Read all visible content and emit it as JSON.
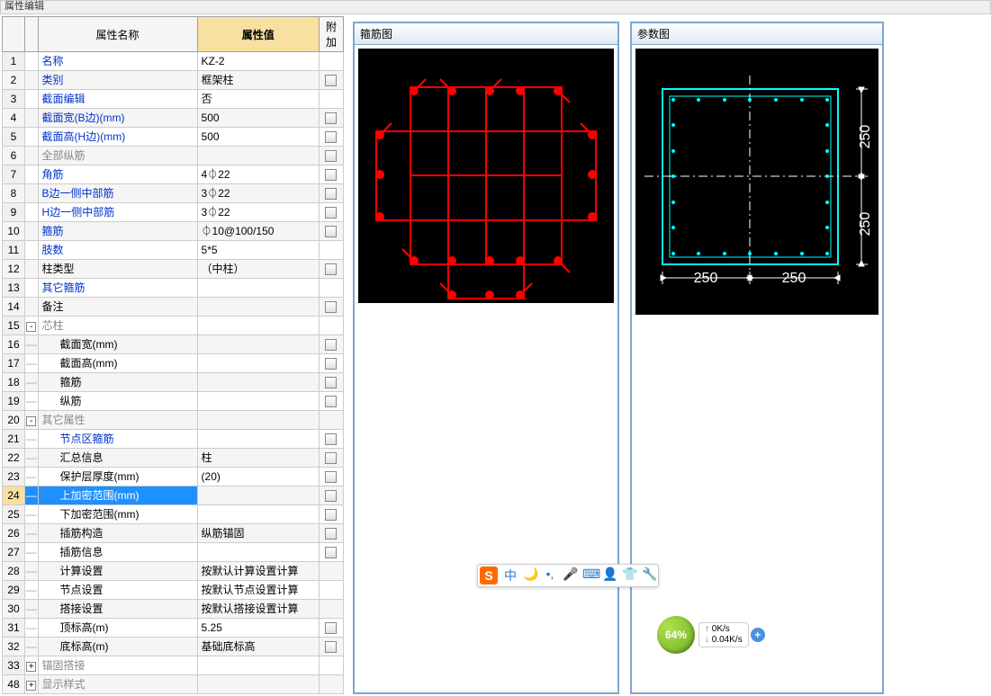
{
  "window_title": "属性编辑",
  "table": {
    "headers": {
      "name": "属性名称",
      "value": "属性值",
      "extra": "附加"
    },
    "rows": [
      {
        "n": "1",
        "name": "名称",
        "value": "KZ-2",
        "blue": true,
        "check": false
      },
      {
        "n": "2",
        "name": "类别",
        "value": "框架柱",
        "blue": true,
        "check": true
      },
      {
        "n": "3",
        "name": "截面编辑",
        "value": "否",
        "blue": true,
        "check": false
      },
      {
        "n": "4",
        "name": "截面宽(B边)(mm)",
        "value": "500",
        "blue": true,
        "check": true
      },
      {
        "n": "5",
        "name": "截面高(H边)(mm)",
        "value": "500",
        "blue": true,
        "check": true
      },
      {
        "n": "6",
        "name": "全部纵筋",
        "value": "",
        "gray": true,
        "check": true
      },
      {
        "n": "7",
        "name": "角筋",
        "value": "4⏀22",
        "blue": true,
        "check": true
      },
      {
        "n": "8",
        "name": "B边一侧中部筋",
        "value": "3⏀22",
        "blue": true,
        "check": true
      },
      {
        "n": "9",
        "name": "H边一侧中部筋",
        "value": "3⏀22",
        "blue": true,
        "check": true
      },
      {
        "n": "10",
        "name": "箍筋",
        "value": "⏀10@100/150",
        "blue": true,
        "check": true
      },
      {
        "n": "11",
        "name": "肢数",
        "value": "5*5",
        "blue": true,
        "check": false
      },
      {
        "n": "12",
        "name": "柱类型",
        "value": "（中柱）",
        "blue": false,
        "check": true
      },
      {
        "n": "13",
        "name": "其它箍筋",
        "value": "",
        "blue": true,
        "check": false
      },
      {
        "n": "14",
        "name": "备注",
        "value": "",
        "blue": false,
        "check": true
      },
      {
        "n": "15",
        "name": "芯柱",
        "value": "",
        "gray": true,
        "expand": "-"
      },
      {
        "n": "16",
        "name": "截面宽(mm)",
        "value": "",
        "blue": false,
        "indent": true,
        "check": true
      },
      {
        "n": "17",
        "name": "截面高(mm)",
        "value": "",
        "blue": false,
        "indent": true,
        "check": true
      },
      {
        "n": "18",
        "name": "箍筋",
        "value": "",
        "blue": false,
        "indent": true,
        "check": true
      },
      {
        "n": "19",
        "name": "纵筋",
        "value": "",
        "blue": false,
        "indent": true,
        "check": true
      },
      {
        "n": "20",
        "name": "其它属性",
        "value": "",
        "gray": true,
        "expand": "-"
      },
      {
        "n": "21",
        "name": "节点区箍筋",
        "value": "",
        "blue": true,
        "indent": true,
        "check": true
      },
      {
        "n": "22",
        "name": "汇总信息",
        "value": "柱",
        "blue": false,
        "indent": true,
        "check": true
      },
      {
        "n": "23",
        "name": "保护层厚度(mm)",
        "value": "(20)",
        "blue": false,
        "indent": true,
        "check": true
      },
      {
        "n": "24",
        "name": "上加密范围(mm)",
        "value": "",
        "blue": false,
        "indent": true,
        "check": true,
        "selected": true
      },
      {
        "n": "25",
        "name": "下加密范围(mm)",
        "value": "",
        "blue": false,
        "indent": true,
        "check": true
      },
      {
        "n": "26",
        "name": "插筋构造",
        "value": "纵筋锚固",
        "blue": false,
        "indent": true,
        "check": true
      },
      {
        "n": "27",
        "name": "插筋信息",
        "value": "",
        "blue": false,
        "indent": true,
        "check": true
      },
      {
        "n": "28",
        "name": "计算设置",
        "value": "按默认计算设置计算",
        "blue": false,
        "indent": true,
        "check": false
      },
      {
        "n": "29",
        "name": "节点设置",
        "value": "按默认节点设置计算",
        "blue": false,
        "indent": true,
        "check": false
      },
      {
        "n": "30",
        "name": "搭接设置",
        "value": "按默认搭接设置计算",
        "blue": false,
        "indent": true,
        "check": false
      },
      {
        "n": "31",
        "name": "顶标高(m)",
        "value": "5.25",
        "blue": false,
        "indent": true,
        "check": true
      },
      {
        "n": "32",
        "name": "底标高(m)",
        "value": "基础底标高",
        "blue": false,
        "indent": true,
        "check": true
      },
      {
        "n": "33",
        "name": "锚固搭接",
        "value": "",
        "gray": true,
        "expand": "+"
      },
      {
        "n": "48",
        "name": "显示样式",
        "value": "",
        "gray": true,
        "expand": "+"
      }
    ]
  },
  "diagrams": {
    "stirrup": {
      "title": "箍筋图"
    },
    "param": {
      "title": "参数图",
      "dims": {
        "top": "250",
        "bottom": "250",
        "left": "250",
        "right": "250"
      }
    }
  },
  "ime": {
    "logo": "S",
    "buttons": [
      "中",
      "🌙",
      "•,",
      "🎤",
      "⌨",
      "👤",
      "👕",
      "🔧"
    ]
  },
  "net": {
    "percent": "64%",
    "up": "0K/s",
    "down": "0.04K/s"
  }
}
